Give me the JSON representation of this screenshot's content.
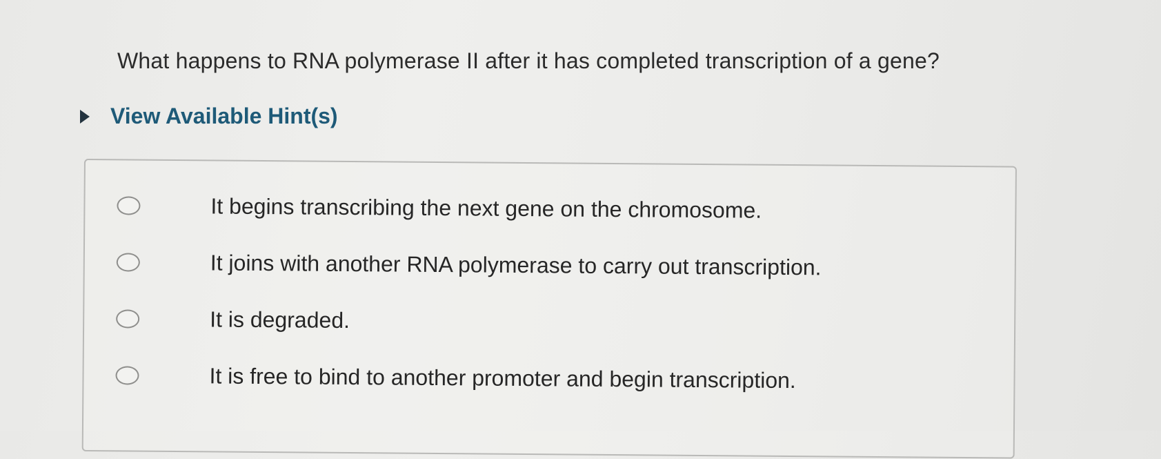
{
  "question": {
    "text": "What happens to RNA polymerase II after it has completed transcription of a gene?"
  },
  "hints": {
    "label": "View Available Hint(s)",
    "icon": "triangle-right-icon"
  },
  "options": [
    {
      "text": "It begins transcribing the next gene on the chromosome.",
      "selected": false
    },
    {
      "text": "It joins with another RNA polymerase to carry out transcription.",
      "selected": false
    },
    {
      "text": "It is degraded.",
      "selected": false
    },
    {
      "text": "It is free to bind to another promoter and begin transcription.",
      "selected": false
    }
  ],
  "colors": {
    "hint_link": "#1e5a78",
    "text": "#2b2b2b",
    "radio_border": "#8e8e8c",
    "box_border": "#b9b9b7"
  }
}
